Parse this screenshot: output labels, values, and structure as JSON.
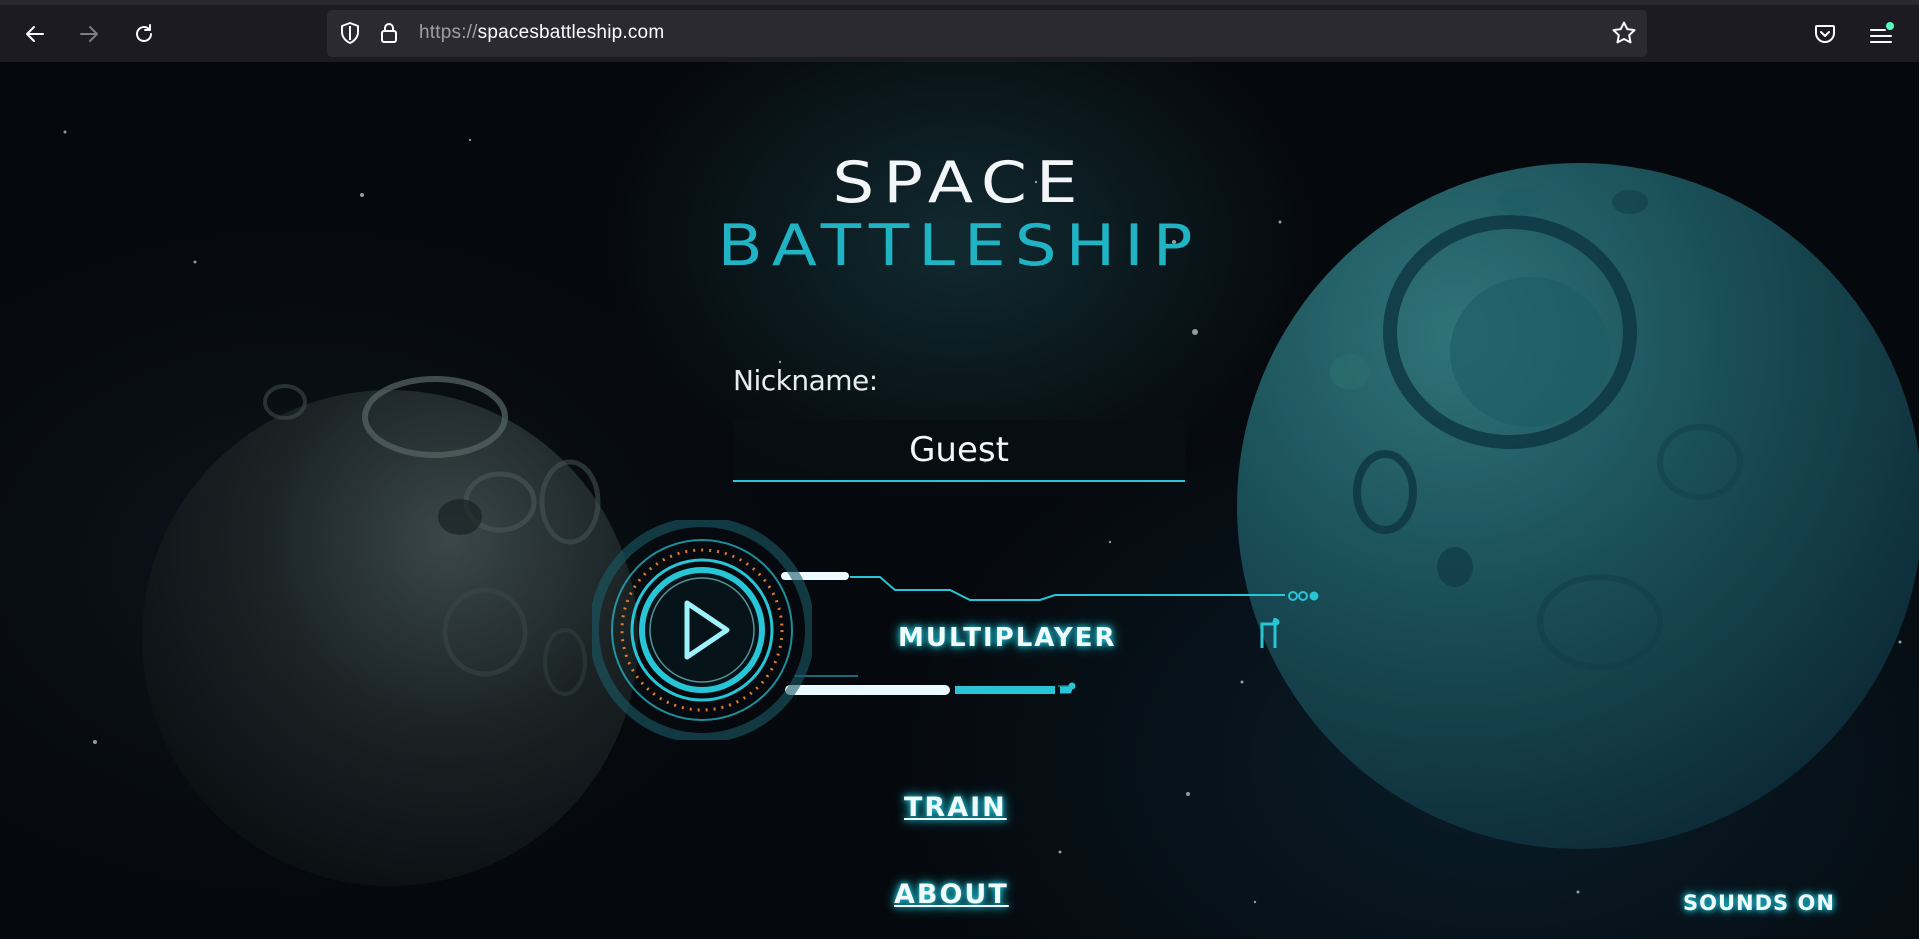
{
  "browser": {
    "url_scheme": "https://",
    "url_host": "spacesbattleship.com",
    "icons": [
      "back-arrow-icon",
      "forward-arrow-icon",
      "reload-icon",
      "shield-icon",
      "lock-icon",
      "star-icon",
      "pocket-icon",
      "hamburger-menu-icon"
    ]
  },
  "game": {
    "title_line1": "SPACE",
    "title_line2": "BATTLESHIP",
    "nickname_label": "Nickname:",
    "nickname_value": "Guest",
    "multiplayer_label": "MULTIPLAYER",
    "train_label": "TRAIN",
    "about_label": "ABOUT",
    "sounds_label": "SOUNDS ON"
  },
  "colors": {
    "accent": "#1fb3c4",
    "glow": "#1ec8dc",
    "orange_dots": "#e07a2a",
    "chrome_bg": "#1c1b22",
    "urlbar_bg": "#2b2a33"
  }
}
